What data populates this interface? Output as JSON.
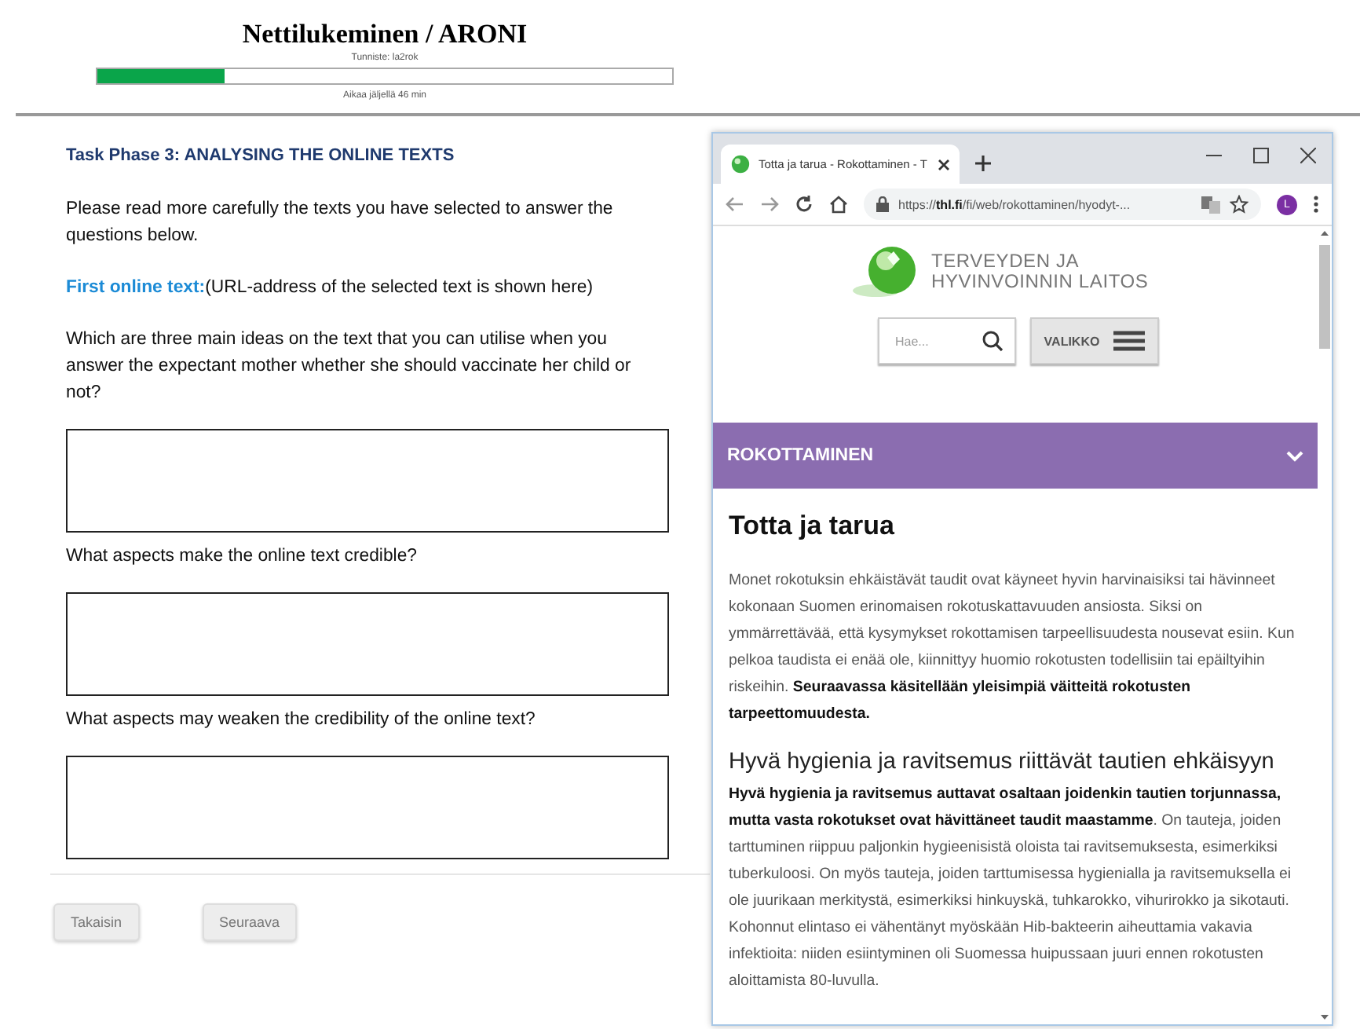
{
  "header": {
    "title": "Nettilukeminen / ARONI",
    "identifier": "Tunniste: la2rok",
    "progress": {
      "level": 0.22
    },
    "time_left": "Aikaa jäljellä 46 min"
  },
  "task": {
    "heading": "Task Phase 3: ANALYSING THE ONLINE TEXTS",
    "intro": "Please read more carefully the texts you have selected to answer the questions below.",
    "first_text_label": "First online text:",
    "first_text_note": "(URL-address of the selected text is shown here)",
    "questions": [
      {
        "text": "Which are three main ideas on the text that you can utilise when you answer the expectant mother whether she should vaccinate her child or not?"
      },
      {
        "text": "What aspects make the online text credible?"
      },
      {
        "text": "What aspects may weaken the credibility of the online text?"
      }
    ]
  },
  "buttons": [
    {
      "label": "Takaisin"
    },
    {
      "label": "Seuraava"
    }
  ],
  "browser": {
    "tab_title": "Totta ja tarua - Rokottaminen - T",
    "url": "https://**thl.fi**/fi/web/rokottaminen/hyodyt-...",
    "profile": "L",
    "site": {
      "logo_lines": [
        "TERVEYDEN JA",
        "HYVINVOINNIN LAITOS"
      ],
      "search_placeholder": "Hae...",
      "menu_label": "VALIKKO",
      "section": "ROKOTTAMINEN",
      "title": "Totta ja tarua",
      "paragraph_1": "Monet rokotuksin ehkäistävät taudit ovat käyneet hyvin harvinaisiksi tai hävinneet kokonaan Suomen erinomaisen rokotuskattavuuden ansiosta. Siksi on ymmärrettävää, että kysymykset rokottamisen tarpeellisuudesta nousevat esiin. Kun pelkoa taudista ei enää ole, kiinnittyy huomio rokotusten todellisiin tai epäiltyihin riskeihin. **Seuraavassa käsitellään yleisimpiä väitteitä rokotusten tarpeettomuudesta.**",
      "subheading": "Hyvä hygienia ja ravitsemus riittävät tautien ehkäisyyn",
      "paragraph_2": "**Hyvä hygienia ja ravitsemus auttavat osaltaan joidenkin tautien torjunnassa, mutta vasta rokotukset ovat hävittäneet taudit maastamme**. On tauteja, joiden tarttuminen riippuu paljonkin hygieenisistä oloista tai ravitsemuksesta, esimerkiksi tuberkuloosi. On myös tauteja, joiden tarttumisessa hygienialla ja ravitsemuksella ei ole juurikaan merkitystä, esimerkiksi hinkuyskä, tuhkarokko, vihurirokko ja sikotauti. Kohonnut elintaso ei vähentänyt myöskään Hib-bakteerin aiheuttamia vakavia infektioita: niiden esiintyminen oli Suomessa huipussaan juuri ennen rokotusten aloittamista 80-luvulla."
    }
  }
}
